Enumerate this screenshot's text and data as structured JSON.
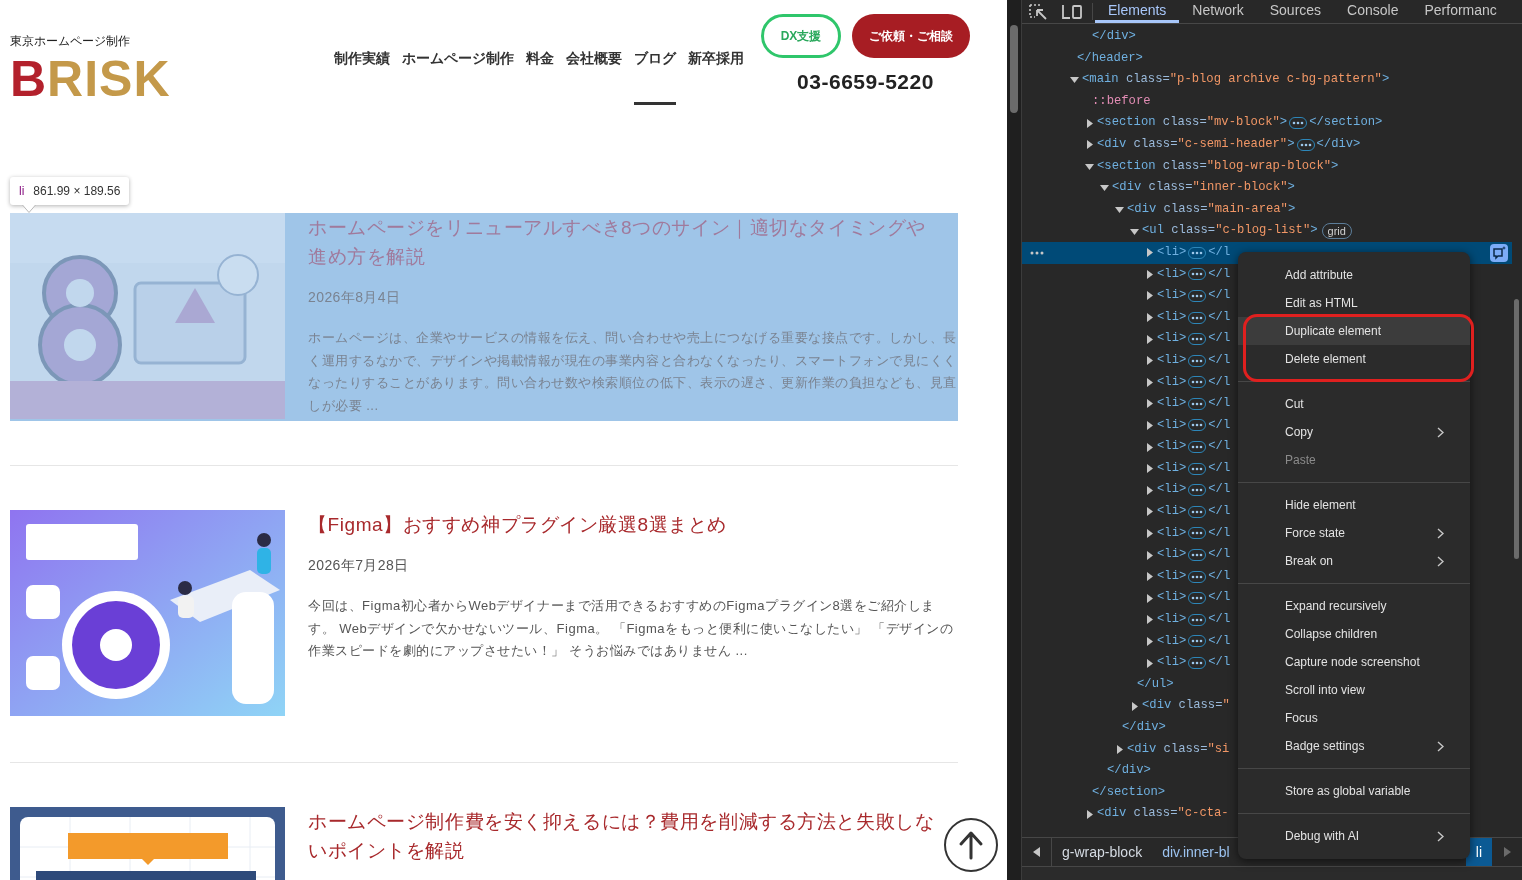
{
  "site": {
    "tagline": "東京ホームページ制作",
    "logo": [
      {
        "text": "B",
        "color": "#b3212c"
      },
      {
        "text": "RISK",
        "color": "#c4994a"
      }
    ],
    "nav": [
      {
        "label": "制作実績",
        "selected": false
      },
      {
        "label": "ホームページ制作",
        "selected": false
      },
      {
        "label": "料金",
        "selected": false
      },
      {
        "label": "会社概要",
        "selected": false
      },
      {
        "label": "ブログ",
        "selected": true
      },
      {
        "label": "新卒採用",
        "selected": false
      }
    ],
    "buttons": [
      {
        "label": "DX支援",
        "kind": "outline"
      },
      {
        "label": "ご依頼・ご相談",
        "kind": "solid"
      }
    ],
    "phone": "03-6659-5220",
    "inspect_tooltip": {
      "tag": "li",
      "size": "861.99 × 189.56"
    },
    "posts": [
      {
        "title": "ホームページをリニューアルすべき8つのサイン｜適切なタイミングや進め方を解説",
        "date": "2026年8月4日",
        "excerpt": "ホームページは、企業やサービスの情報を伝え、問い合わせや売上につなげる重要な接点です。しかし、長く運用するなかで、デザインや掲載情報が現在の事業内容と合わなくなったり、スマートフォンで見にくくなったりすることがあります。問い合わせ数や検索順位の低下、表示の遅さ、更新作業の負担なども、見直しが必要 ...",
        "highlighted": true
      },
      {
        "title": "【Figma】おすすめ神プラグイン厳選8選まとめ",
        "date": "2026年7月28日",
        "excerpt": "今回は、Figma初心者からWebデザイナーまで活用できるおすすめのFigmaプラグイン8選をご紹介します。 Webデザインで欠かせないツール、Figma。 「Figmaをもっと便利に使いこなしたい」 「デザインの作業スピードを劇的にアップさせたい！」 そうお悩みではありません ...",
        "highlighted": false
      },
      {
        "title": "ホームページ制作費を安く抑えるには？費用を削減する方法と失敗しないポイントを解説",
        "highlighted": false
      }
    ]
  },
  "devtools": {
    "tabs": [
      {
        "label": "Elements",
        "selected": true
      },
      {
        "label": "Network",
        "selected": false
      },
      {
        "label": "Sources",
        "selected": false
      },
      {
        "label": "Console",
        "selected": false
      },
      {
        "label": "Performanc",
        "selected": false
      }
    ],
    "dom_tree": [
      {
        "selected": false,
        "children": [
          {
            "parts": [
              {
                "kind": "tag",
                "t": "</div>"
              }
            ],
            "selected": false
          }
        ],
        "close": [
          {
            "kind": "tag",
            "t": "</header>"
          }
        ]
      },
      {
        "parts": [
          {
            "kind": "tag",
            "t": "<main"
          },
          {
            "kind": "attr",
            "t": " class="
          },
          {
            "kind": "value",
            "t": "\"p-blog archive c-bg-pattern\""
          },
          {
            "kind": "tag",
            "t": ">"
          }
        ],
        "expanded": true,
        "selected": false,
        "children": [
          {
            "parts": [
              {
                "kind": "pseudo",
                "t": "::before"
              }
            ],
            "selected": false
          },
          {
            "parts": [
              {
                "kind": "tag",
                "t": "<section"
              },
              {
                "kind": "attr",
                "t": " class="
              },
              {
                "kind": "value",
                "t": "\"mv-block\""
              },
              {
                "kind": "tag",
                "t": ">"
              },
              {
                "kind": "more"
              },
              {
                "kind": "tag",
                "t": "</section>"
              }
            ],
            "expanded": false,
            "selected": false
          },
          {
            "parts": [
              {
                "kind": "tag",
                "t": "<div"
              },
              {
                "kind": "attr",
                "t": " class="
              },
              {
                "kind": "value",
                "t": "\"c-semi-header\""
              },
              {
                "kind": "tag",
                "t": ">"
              },
              {
                "kind": "more"
              },
              {
                "kind": "tag",
                "t": "</div>"
              }
            ],
            "expanded": false,
            "selected": false
          },
          {
            "parts": [
              {
                "kind": "tag",
                "t": "<section"
              },
              {
                "kind": "attr",
                "t": " class="
              },
              {
                "kind": "value",
                "t": "\"blog-wrap-block\""
              },
              {
                "kind": "tag",
                "t": ">"
              }
            ],
            "expanded": true,
            "selected": false,
            "close": [
              {
                "kind": "tag",
                "t": "</section>"
              }
            ],
            "children": [
              {
                "parts": [
                  {
                    "kind": "tag",
                    "t": "<div"
                  },
                  {
                    "kind": "attr",
                    "t": " class="
                  },
                  {
                    "kind": "value",
                    "t": "\"inner-block\""
                  },
                  {
                    "kind": "tag",
                    "t": ">"
                  }
                ],
                "expanded": true,
                "selected": false,
                "close": [
                  {
                    "kind": "tag",
                    "t": "</div>"
                  }
                ],
                "children": [
                  {
                    "parts": [
                      {
                        "kind": "tag",
                        "t": "<div"
                      },
                      {
                        "kind": "attr",
                        "t": " class="
                      },
                      {
                        "kind": "value",
                        "t": "\"main-area\""
                      },
                      {
                        "kind": "tag",
                        "t": ">"
                      }
                    ],
                    "expanded": true,
                    "selected": false,
                    "close": [
                      {
                        "kind": "tag",
                        "t": "</div>"
                      }
                    ],
                    "children": [
                      {
                        "parts": [
                          {
                            "kind": "tag",
                            "t": "<ul"
                          },
                          {
                            "kind": "attr",
                            "t": " class="
                          },
                          {
                            "kind": "value",
                            "t": "\"c-blog-list\""
                          },
                          {
                            "kind": "tag",
                            "t": ">"
                          },
                          {
                            "kind": "badge",
                            "t": "grid"
                          }
                        ],
                        "expanded": true,
                        "selected": false,
                        "close": [
                          {
                            "kind": "tag",
                            "t": "</ul>"
                          }
                        ],
                        "children": [
                          {
                            "parts": [
                              {
                                "kind": "tag",
                                "t": "<li>"
                              },
                              {
                                "kind": "more"
                              },
                              {
                                "kind": "tag",
                                "t": "</l"
                              }
                            ],
                            "expanded": false,
                            "selected": true
                          },
                          {
                            "parts": [
                              {
                                "kind": "tag",
                                "t": "<li>"
                              },
                              {
                                "kind": "more"
                              },
                              {
                                "kind": "tag",
                                "t": "</l"
                              }
                            ],
                            "expanded": false,
                            "selected": false
                          },
                          {
                            "parts": [
                              {
                                "kind": "tag",
                                "t": "<li>"
                              },
                              {
                                "kind": "more"
                              },
                              {
                                "kind": "tag",
                                "t": "</l"
                              }
                            ],
                            "expanded": false,
                            "selected": false
                          },
                          {
                            "parts": [
                              {
                                "kind": "tag",
                                "t": "<li>"
                              },
                              {
                                "kind": "more"
                              },
                              {
                                "kind": "tag",
                                "t": "</l"
                              }
                            ],
                            "expanded": false,
                            "selected": false
                          },
                          {
                            "parts": [
                              {
                                "kind": "tag",
                                "t": "<li>"
                              },
                              {
                                "kind": "more"
                              },
                              {
                                "kind": "tag",
                                "t": "</l"
                              }
                            ],
                            "expanded": false,
                            "selected": false
                          },
                          {
                            "parts": [
                              {
                                "kind": "tag",
                                "t": "<li>"
                              },
                              {
                                "kind": "more"
                              },
                              {
                                "kind": "tag",
                                "t": "</l"
                              }
                            ],
                            "expanded": false,
                            "selected": false
                          },
                          {
                            "parts": [
                              {
                                "kind": "tag",
                                "t": "<li>"
                              },
                              {
                                "kind": "more"
                              },
                              {
                                "kind": "tag",
                                "t": "</l"
                              }
                            ],
                            "expanded": false,
                            "selected": false
                          },
                          {
                            "parts": [
                              {
                                "kind": "tag",
                                "t": "<li>"
                              },
                              {
                                "kind": "more"
                              },
                              {
                                "kind": "tag",
                                "t": "</l"
                              }
                            ],
                            "expanded": false,
                            "selected": false
                          },
                          {
                            "parts": [
                              {
                                "kind": "tag",
                                "t": "<li>"
                              },
                              {
                                "kind": "more"
                              },
                              {
                                "kind": "tag",
                                "t": "</l"
                              }
                            ],
                            "expanded": false,
                            "selected": false
                          },
                          {
                            "parts": [
                              {
                                "kind": "tag",
                                "t": "<li>"
                              },
                              {
                                "kind": "more"
                              },
                              {
                                "kind": "tag",
                                "t": "</l"
                              }
                            ],
                            "expanded": false,
                            "selected": false
                          },
                          {
                            "parts": [
                              {
                                "kind": "tag",
                                "t": "<li>"
                              },
                              {
                                "kind": "more"
                              },
                              {
                                "kind": "tag",
                                "t": "</l"
                              }
                            ],
                            "expanded": false,
                            "selected": false
                          },
                          {
                            "parts": [
                              {
                                "kind": "tag",
                                "t": "<li>"
                              },
                              {
                                "kind": "more"
                              },
                              {
                                "kind": "tag",
                                "t": "</l"
                              }
                            ],
                            "expanded": false,
                            "selected": false
                          },
                          {
                            "parts": [
                              {
                                "kind": "tag",
                                "t": "<li>"
                              },
                              {
                                "kind": "more"
                              },
                              {
                                "kind": "tag",
                                "t": "</l"
                              }
                            ],
                            "expanded": false,
                            "selected": false
                          },
                          {
                            "parts": [
                              {
                                "kind": "tag",
                                "t": "<li>"
                              },
                              {
                                "kind": "more"
                              },
                              {
                                "kind": "tag",
                                "t": "</l"
                              }
                            ],
                            "expanded": false,
                            "selected": false
                          },
                          {
                            "parts": [
                              {
                                "kind": "tag",
                                "t": "<li>"
                              },
                              {
                                "kind": "more"
                              },
                              {
                                "kind": "tag",
                                "t": "</l"
                              }
                            ],
                            "expanded": false,
                            "selected": false
                          },
                          {
                            "parts": [
                              {
                                "kind": "tag",
                                "t": "<li>"
                              },
                              {
                                "kind": "more"
                              },
                              {
                                "kind": "tag",
                                "t": "</l"
                              }
                            ],
                            "expanded": false,
                            "selected": false
                          },
                          {
                            "parts": [
                              {
                                "kind": "tag",
                                "t": "<li>"
                              },
                              {
                                "kind": "more"
                              },
                              {
                                "kind": "tag",
                                "t": "</l"
                              }
                            ],
                            "expanded": false,
                            "selected": false
                          },
                          {
                            "parts": [
                              {
                                "kind": "tag",
                                "t": "<li>"
                              },
                              {
                                "kind": "more"
                              },
                              {
                                "kind": "tag",
                                "t": "</l"
                              }
                            ],
                            "expanded": false,
                            "selected": false
                          },
                          {
                            "parts": [
                              {
                                "kind": "tag",
                                "t": "<li>"
                              },
                              {
                                "kind": "more"
                              },
                              {
                                "kind": "tag",
                                "t": "</l"
                              }
                            ],
                            "expanded": false,
                            "selected": false
                          },
                          {
                            "parts": [
                              {
                                "kind": "tag",
                                "t": "<li>"
                              },
                              {
                                "kind": "more"
                              },
                              {
                                "kind": "tag",
                                "t": "</l"
                              }
                            ],
                            "expanded": false,
                            "selected": false
                          }
                        ]
                      },
                      {
                        "parts": [
                          {
                            "kind": "tag",
                            "t": "<div"
                          },
                          {
                            "kind": "attr",
                            "t": " class="
                          },
                          {
                            "kind": "value",
                            "t": "\""
                          }
                        ],
                        "expanded": false,
                        "selected": false
                      }
                    ]
                  },
                  {
                    "parts": [
                      {
                        "kind": "tag",
                        "t": "<div"
                      },
                      {
                        "kind": "attr",
                        "t": " class="
                      },
                      {
                        "kind": "value",
                        "t": "\"si"
                      }
                    ],
                    "expanded": false,
                    "selected": false
                  }
                ]
              }
            ]
          },
          {
            "parts": [
              {
                "kind": "tag",
                "t": "<div"
              },
              {
                "kind": "attr",
                "t": " class="
              },
              {
                "kind": "value",
                "t": "\"c-cta-"
              }
            ],
            "expanded": false,
            "selected": false
          }
        ]
      }
    ],
    "context_menu": [
      {
        "kind": "item",
        "label": "Add attribute",
        "selected": false,
        "disabled": false,
        "submenu": false
      },
      {
        "kind": "item",
        "label": "Edit as HTML",
        "selected": false,
        "disabled": false,
        "submenu": false
      },
      {
        "kind": "item",
        "label": "Duplicate element",
        "selected": true,
        "disabled": false,
        "submenu": false
      },
      {
        "kind": "item",
        "label": "Delete element",
        "selected": false,
        "disabled": false,
        "submenu": false
      },
      {
        "kind": "separator"
      },
      {
        "kind": "item",
        "label": "Cut",
        "selected": false,
        "disabled": false,
        "submenu": false
      },
      {
        "kind": "item",
        "label": "Copy",
        "selected": false,
        "disabled": false,
        "submenu": true
      },
      {
        "kind": "item",
        "label": "Paste",
        "selected": false,
        "disabled": true,
        "submenu": false
      },
      {
        "kind": "separator"
      },
      {
        "kind": "item",
        "label": "Hide element",
        "selected": false,
        "disabled": false,
        "submenu": false
      },
      {
        "kind": "item",
        "label": "Force state",
        "selected": false,
        "disabled": false,
        "submenu": true
      },
      {
        "kind": "item",
        "label": "Break on",
        "selected": false,
        "disabled": false,
        "submenu": true
      },
      {
        "kind": "separator"
      },
      {
        "kind": "item",
        "label": "Expand recursively",
        "selected": false,
        "disabled": false,
        "submenu": false
      },
      {
        "kind": "item",
        "label": "Collapse children",
        "selected": false,
        "disabled": false,
        "submenu": false
      },
      {
        "kind": "item",
        "label": "Capture node screenshot",
        "selected": false,
        "disabled": false,
        "submenu": false
      },
      {
        "kind": "item",
        "label": "Scroll into view",
        "selected": false,
        "disabled": false,
        "submenu": false
      },
      {
        "kind": "item",
        "label": "Focus",
        "selected": false,
        "disabled": false,
        "submenu": false
      },
      {
        "kind": "item",
        "label": "Badge settings",
        "selected": false,
        "disabled": false,
        "submenu": true
      },
      {
        "kind": "separator"
      },
      {
        "kind": "item",
        "label": "Store as global variable",
        "selected": false,
        "disabled": false,
        "submenu": false
      },
      {
        "kind": "separator"
      },
      {
        "kind": "item",
        "label": "Debug with AI",
        "selected": false,
        "disabled": false,
        "submenu": true
      }
    ],
    "breadcrumbs": [
      {
        "label": "g-wrap-block",
        "selected": false
      },
      {
        "label": "div.inner-bl",
        "selected": false
      },
      {
        "label": "li",
        "selected": true
      }
    ]
  }
}
